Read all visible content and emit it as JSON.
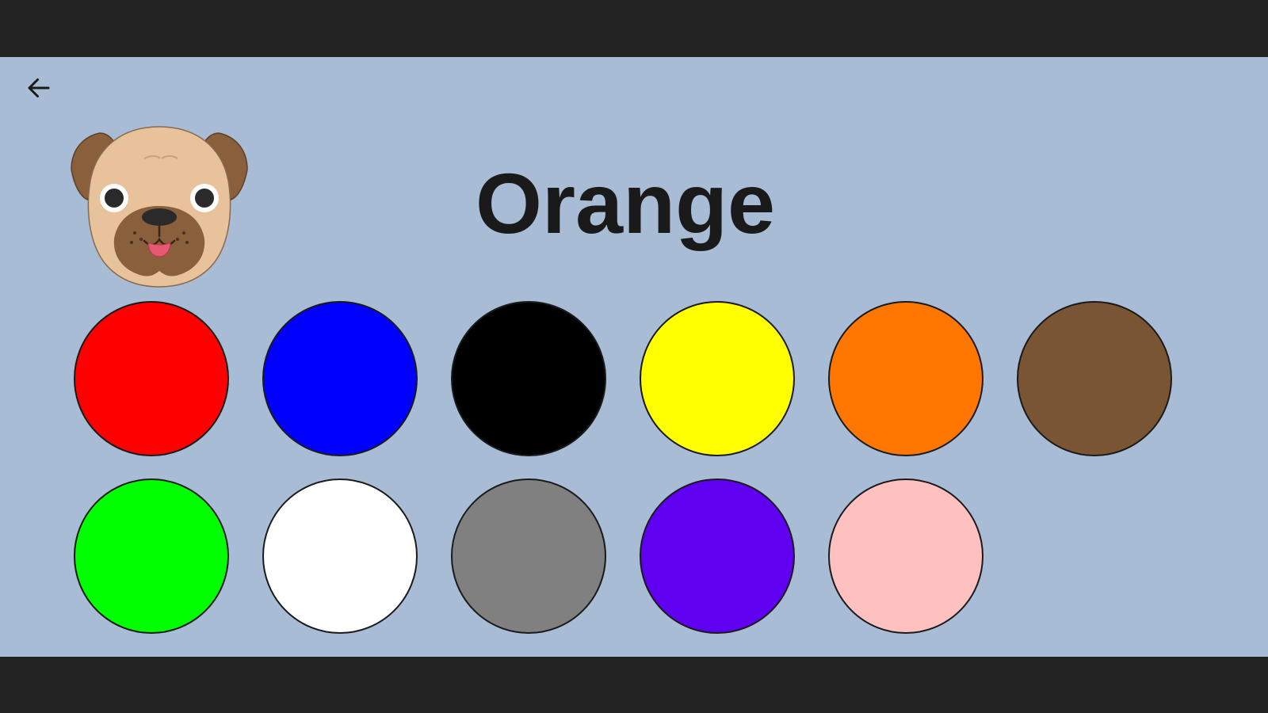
{
  "title": "Orange",
  "back_icon": "arrow-left-icon",
  "mascot_icon": "pug-face-icon",
  "colors": {
    "screen_background": "#a8bcd6",
    "frame": "#222222"
  },
  "swatches": [
    {
      "name": "red",
      "color": "#ff0000"
    },
    {
      "name": "blue",
      "color": "#0000ff"
    },
    {
      "name": "black",
      "color": "#000000"
    },
    {
      "name": "yellow",
      "color": "#ffff00"
    },
    {
      "name": "orange",
      "color": "#ff7700"
    },
    {
      "name": "brown",
      "color": "#7a5533"
    },
    {
      "name": "green",
      "color": "#00ff00"
    },
    {
      "name": "white",
      "color": "#ffffff"
    },
    {
      "name": "gray",
      "color": "#808080"
    },
    {
      "name": "purple",
      "color": "#6000f0"
    },
    {
      "name": "pink",
      "color": "#ffc0c0"
    }
  ]
}
